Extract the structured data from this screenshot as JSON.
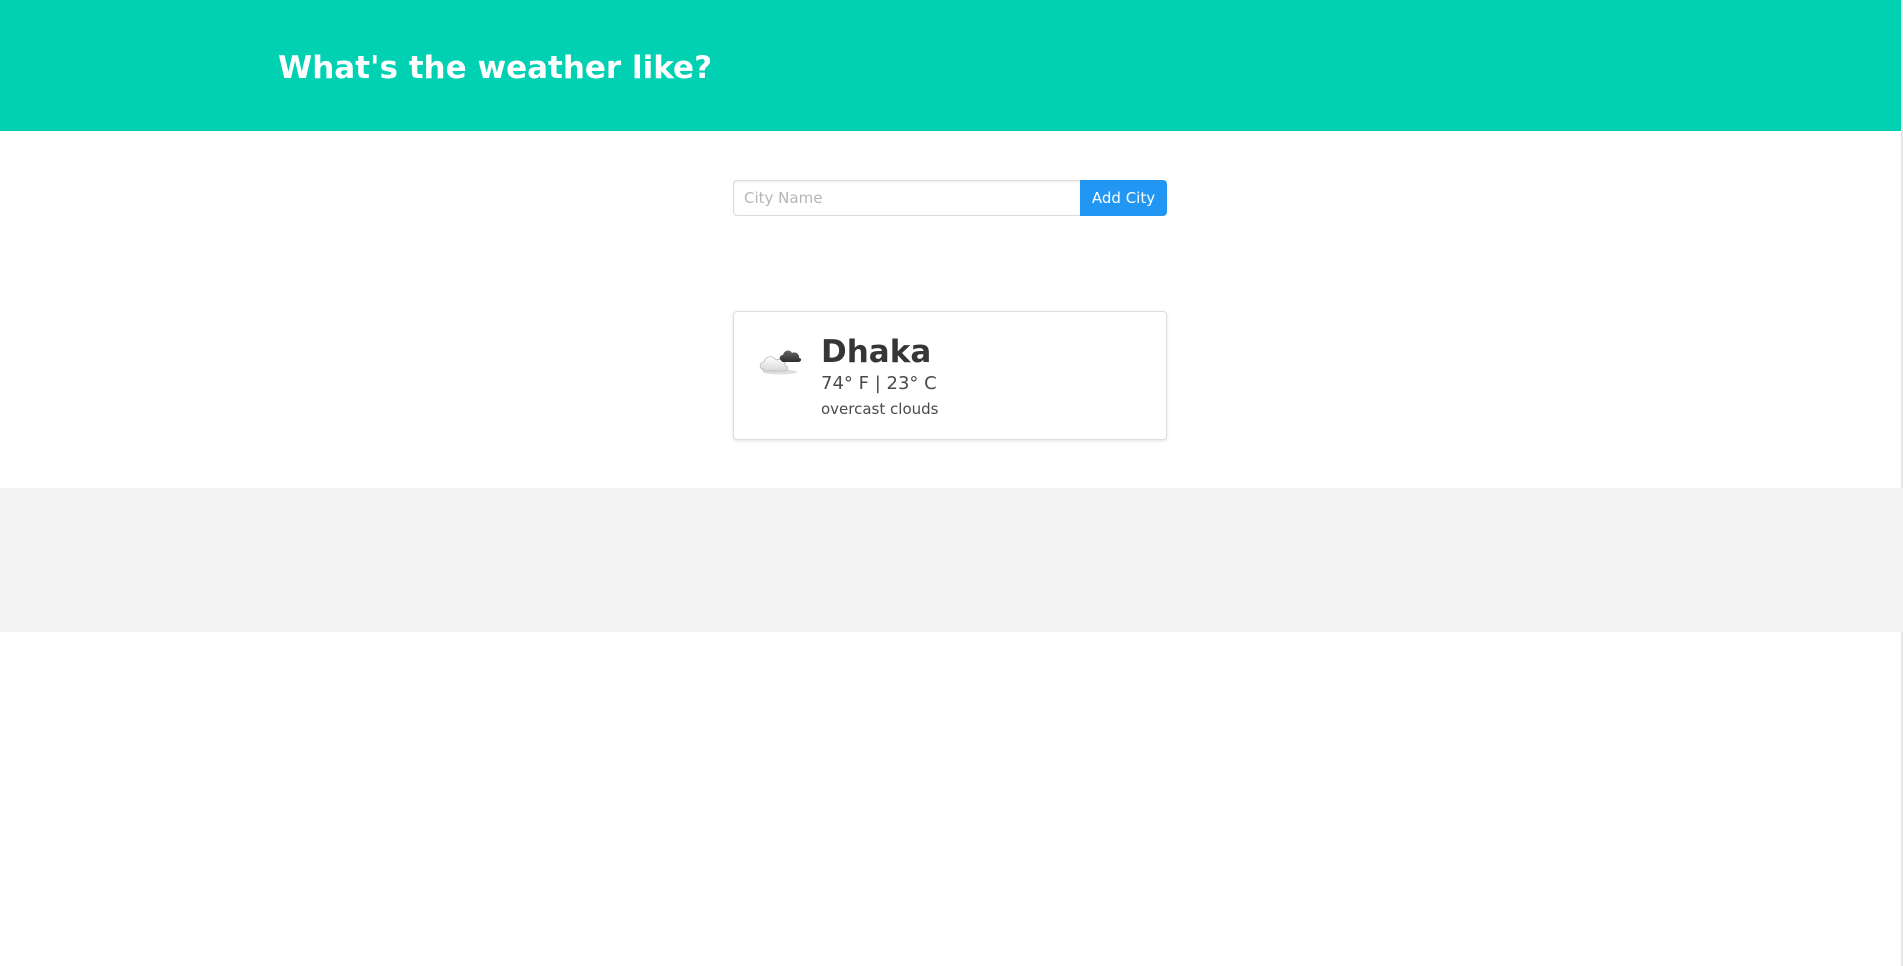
{
  "header": {
    "title": "What's the weather like?"
  },
  "search": {
    "placeholder": "City Name",
    "value": "",
    "button_label": "Add City"
  },
  "cards": [
    {
      "city": "Dhaka",
      "temps": "74° F | 23° C",
      "description": "overcast clouds",
      "icon": "overcast-clouds-icon"
    }
  ],
  "colors": {
    "hero": "#00d1b2",
    "button": "#2196f3",
    "footer": "#f4f4f4"
  }
}
